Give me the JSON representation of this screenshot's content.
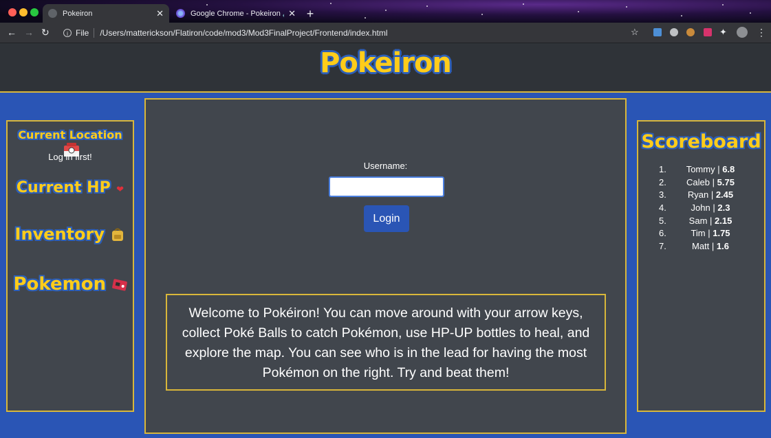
{
  "browser": {
    "tabs": [
      {
        "title": "Pokeiron",
        "active": true
      },
      {
        "title": "Google Chrome - Pokeiron 🔊",
        "active": false
      }
    ],
    "address": {
      "scheme": "File",
      "path": "/Users/matterickson/Flatiron/code/mod3/Mod3FinalProject/Frontend/index.html"
    },
    "icons": [
      "back-icon",
      "forward-icon",
      "reload-icon",
      "info-icon",
      "star-icon",
      "extension-icon",
      "profile-avatar",
      "menu-icon"
    ]
  },
  "header": {
    "logo": "Pokeiron"
  },
  "sidebar": {
    "location_title": "Current Location",
    "location_message": "Log in first!",
    "hp_title": "Current HP",
    "inventory_title": "Inventory",
    "pokemon_title": "Pokemon"
  },
  "login": {
    "label": "Username:",
    "value": "",
    "button": "Login"
  },
  "welcome": "Welcome to Pokéiron! You can move around with your arrow keys, collect Poké Balls to catch Pokémon, use HP-UP bottles to heal, and explore the map. You can see who is in the lead for having the most Pokémon on the right. Try and beat them!",
  "scoreboard": {
    "title": "Scoreboard",
    "entries": [
      {
        "rank": "1.",
        "name": "Tommy",
        "score": "6.8"
      },
      {
        "rank": "2.",
        "name": "Caleb",
        "score": "5.75"
      },
      {
        "rank": "3.",
        "name": "Ryan",
        "score": "2.45"
      },
      {
        "rank": "4.",
        "name": "John",
        "score": "2.3"
      },
      {
        "rank": "5.",
        "name": "Sam",
        "score": "2.15"
      },
      {
        "rank": "6.",
        "name": "Tim",
        "score": "1.75"
      },
      {
        "rank": "7.",
        "name": "Matt",
        "score": "1.6"
      }
    ]
  },
  "colors": {
    "accent": "#d9b73a",
    "page_bg": "#2a55b5",
    "panel_bg": "#41464d",
    "logo_yellow": "#ffcc1a"
  }
}
